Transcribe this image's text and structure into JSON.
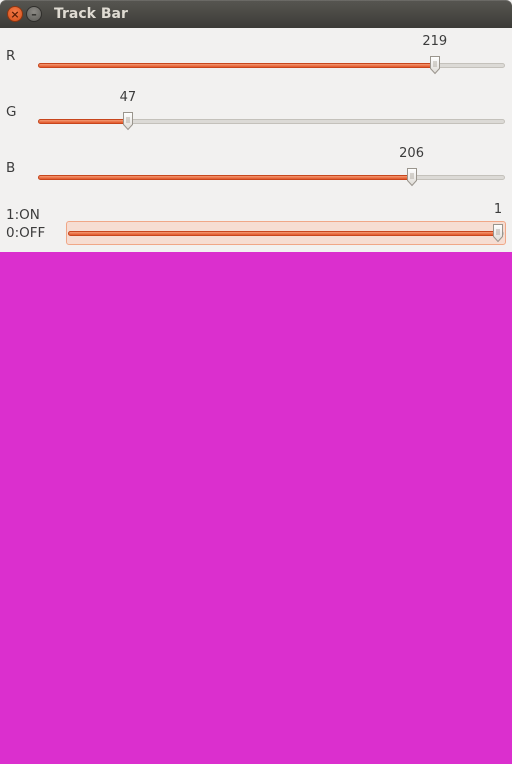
{
  "window": {
    "title": "Track Bar"
  },
  "trackbars": [
    {
      "id": "r",
      "label": "R",
      "value": 219,
      "max": 255
    },
    {
      "id": "g",
      "label": "G",
      "value": 47,
      "max": 255
    },
    {
      "id": "b",
      "label": "B",
      "value": 206,
      "max": 255
    },
    {
      "id": "switch",
      "label_line1": "1:ON",
      "label_line2": "0:OFF",
      "value": 1,
      "max": 1
    }
  ],
  "preview": {
    "color": "#db2fce"
  },
  "colors": {
    "accent": "#e2572a",
    "window_bg": "#f2f1f0",
    "titlebar": "#3c3b37"
  }
}
